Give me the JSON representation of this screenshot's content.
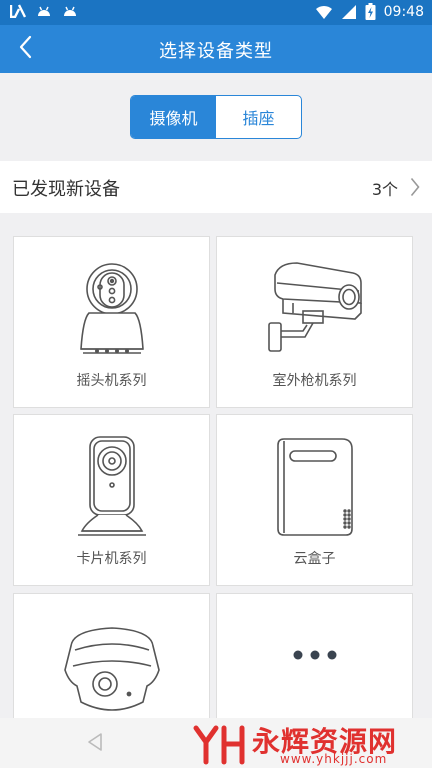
{
  "status_bar": {
    "time": "09:48",
    "left_icons": [
      "app-notification-icon",
      "android-icon",
      "android-icon"
    ],
    "right_icons": [
      "wifi-icon",
      "signal-icon",
      "battery-charging-icon"
    ]
  },
  "app_bar": {
    "title": "选择设备类型",
    "back_icon": "chevron-left-icon",
    "background": "#2a86d8"
  },
  "segmented_control": {
    "tabs": [
      {
        "label": "摄像机",
        "active": true
      },
      {
        "label": "插座",
        "active": false
      }
    ]
  },
  "found_devices": {
    "label": "已发现新设备",
    "count": "3个"
  },
  "device_types": [
    {
      "label": "摇头机系列",
      "icon": "pan-tilt-camera-icon"
    },
    {
      "label": "室外枪机系列",
      "icon": "bullet-camera-icon"
    },
    {
      "label": "卡片机系列",
      "icon": "card-camera-icon"
    },
    {
      "label": "云盒子",
      "icon": "cloud-box-icon"
    },
    {
      "label": "",
      "icon": "panoramic-camera-icon"
    },
    {
      "label": "",
      "icon": "more-icon"
    }
  ],
  "watermark": {
    "title": "永辉资源网",
    "url": "www.yhkjjj.com"
  },
  "colors": {
    "accent": "#2a86d8",
    "status_bar": "#1b74c2",
    "watermark": "#e0312f"
  }
}
